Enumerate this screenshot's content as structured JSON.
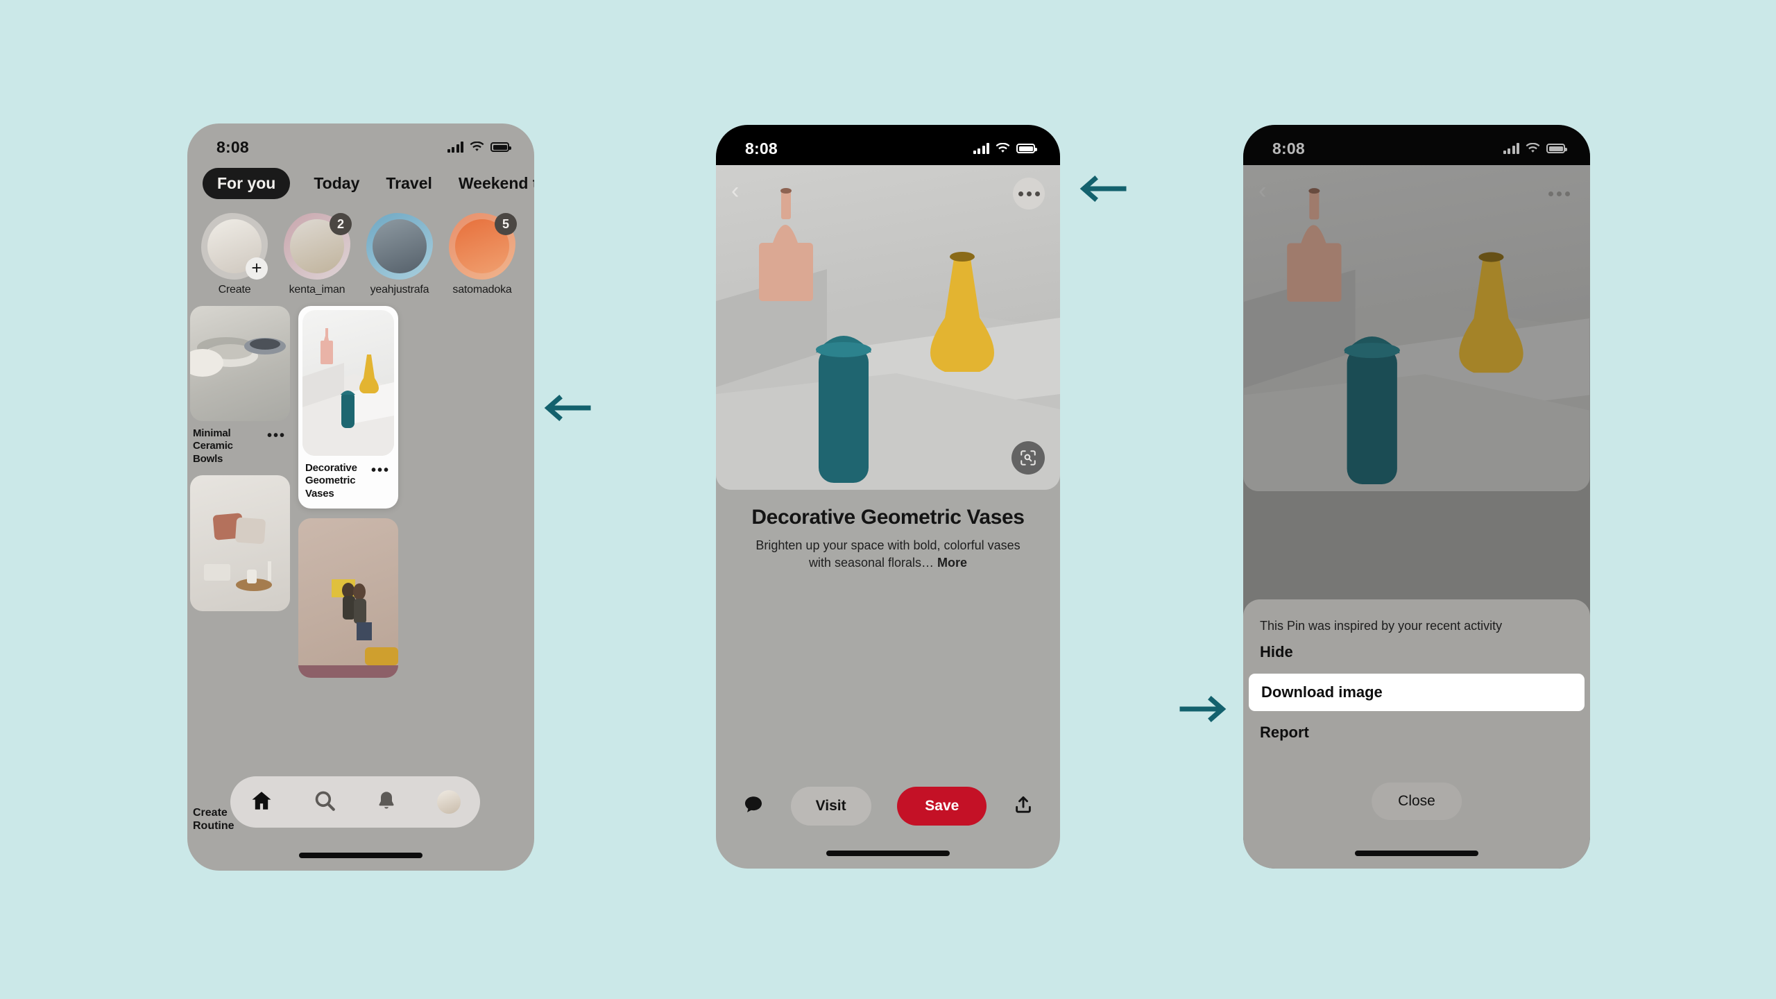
{
  "meta": {
    "background_color": "#cbe8e8",
    "accent_arrow_color": "#13616d",
    "brand_red": "#c41126"
  },
  "phone1": {
    "name": "home-feed",
    "status": {
      "time": "8:08"
    },
    "tabs": [
      {
        "label": "For you",
        "active": true
      },
      {
        "label": "Today",
        "active": false
      },
      {
        "label": "Travel",
        "active": false
      },
      {
        "label": "Weekend trip",
        "active": false
      }
    ],
    "avatars": [
      {
        "name": "Create",
        "badge": "",
        "plus": "+"
      },
      {
        "name": "kenta_iman",
        "badge": "2",
        "plus": ""
      },
      {
        "name": "yeahjustrafa",
        "badge": "",
        "plus": ""
      },
      {
        "name": "satomadoka",
        "badge": "5",
        "plus": ""
      }
    ],
    "pins": [
      {
        "title": "Minimal Ceramic Bowls",
        "menu": "•••",
        "selected": false
      },
      {
        "title": "Decorative Geometric Vases",
        "menu": "•••",
        "selected": true
      }
    ],
    "create_routine_label": "Create Routine",
    "tabbar": [
      {
        "icon": "home-icon",
        "active": true
      },
      {
        "icon": "search-icon",
        "active": false
      },
      {
        "icon": "bell-icon",
        "active": false
      },
      {
        "icon": "profile-avatar-icon",
        "active": false
      }
    ]
  },
  "phone2": {
    "name": "pin-detail",
    "status": {
      "time": "8:08"
    },
    "back_icon": "chevron-left-icon",
    "more_icon": "overflow-menu-icon",
    "lens_icon": "visual-search-icon",
    "title": "Decorative Geometric Vases",
    "description": "Brighten up your space with bold, colorful vases with seasonal florals…",
    "more_link": "More",
    "actions": {
      "comment_icon": "comment-icon",
      "visit_label": "Visit",
      "save_label": "Save",
      "share_icon": "share-icon"
    }
  },
  "phone3": {
    "name": "pin-overflow-sheet",
    "status": {
      "time": "8:08"
    },
    "sheet": {
      "note": "This Pin was inspired by your recent activity",
      "items": [
        {
          "label": "Hide",
          "selected": false
        },
        {
          "label": "Download image",
          "selected": true
        },
        {
          "label": "Report",
          "selected": false
        }
      ],
      "close_label": "Close"
    }
  },
  "annotations": [
    {
      "name": "arrow-to-pin-card",
      "direction": "left"
    },
    {
      "name": "arrow-to-overflow-button",
      "direction": "left"
    },
    {
      "name": "arrow-to-download-image",
      "direction": "right"
    }
  ]
}
